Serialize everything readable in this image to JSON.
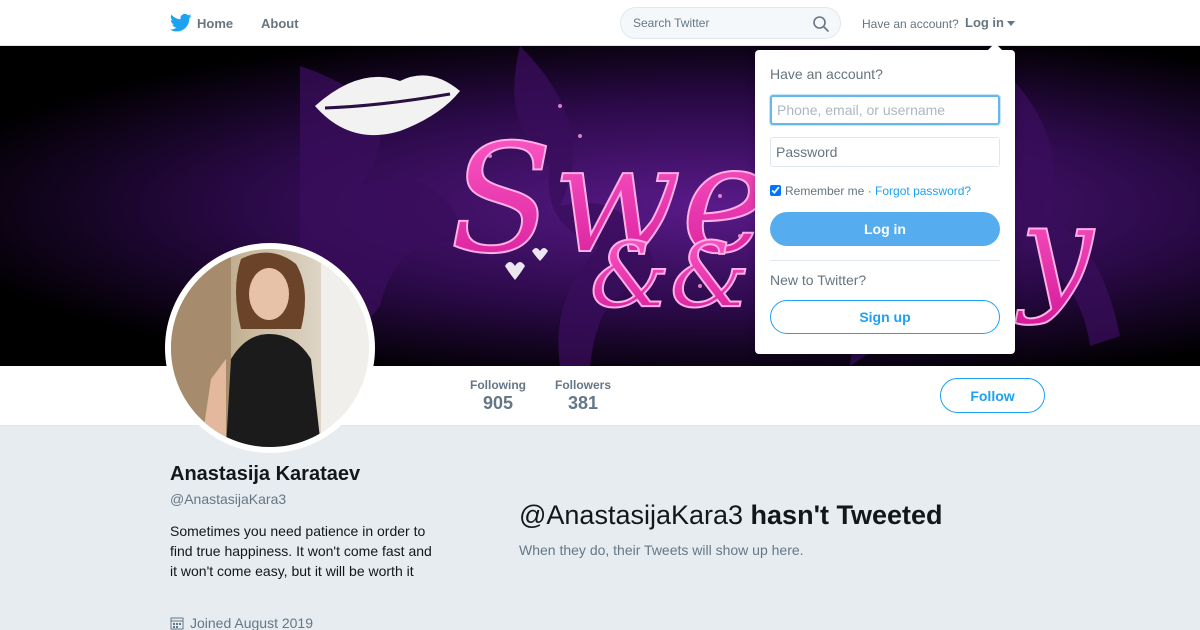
{
  "nav": {
    "home_label": "Home",
    "about_label": "About",
    "search_placeholder": "Search Twitter",
    "have_account": "Have an account?",
    "login_label": "Log in"
  },
  "banner": {
    "text_line1": "Swe",
    "text_line2": "&&",
    "text_tail": "y"
  },
  "profile": {
    "name": "Anastasija Karataev",
    "handle": "@AnastasijaKara3",
    "bio": "Sometimes you need patience in order to find true happiness. It won't come fast and it won't come easy, but it will be worth it",
    "joined": "Joined August 2019"
  },
  "stats": [
    {
      "label": "Following",
      "value": "905"
    },
    {
      "label": "Followers",
      "value": "381"
    }
  ],
  "follow_label": "Follow",
  "empty_state": {
    "handle": "@AnastasijaKara3",
    "title_suffix": "hasn't Tweeted",
    "subtitle": "When they do, their Tweets will show up here."
  },
  "login_dropdown": {
    "heading": "Have an account?",
    "username_placeholder": "Phone, email, or username",
    "password_placeholder": "Password",
    "remember_label": "Remember me",
    "separator": "·",
    "forgot_label": "Forgot password?",
    "login_button": "Log in",
    "new_prompt": "New to Twitter?",
    "signup_button": "Sign up"
  },
  "colors": {
    "brand_blue": "#1da1f2",
    "login_button_blue": "#55acee",
    "background": "#e6ecf0"
  }
}
